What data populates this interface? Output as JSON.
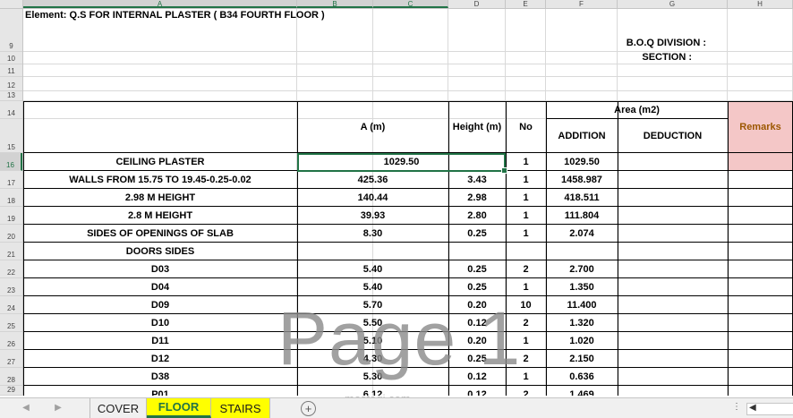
{
  "columns": [
    "A",
    "B",
    "C",
    "D",
    "E",
    "F",
    "G",
    "H"
  ],
  "row_numbers": [
    "9",
    "10",
    "11",
    "12",
    "13",
    "14",
    "15",
    "16",
    "17",
    "18",
    "19",
    "20",
    "21",
    "22",
    "23",
    "24",
    "25",
    "26",
    "27",
    "28",
    "29"
  ],
  "sheet": {
    "element_label": "Element: Q.S FOR INTERNAL PLASTER  ( B34 FOURTH FLOOR )",
    "boq_division": "B.O.Q DIVISION :",
    "section": "SECTION :"
  },
  "table_header": {
    "a_m": "A (m)",
    "height_m": "Height (m)",
    "no": "No",
    "area_m2": "Area  (m2)",
    "addition": "ADDITION",
    "deduction": "DEDUCTION",
    "remarks": "Remarks"
  },
  "rows": [
    {
      "label": "CEILING PLASTER",
      "a": "1029.50",
      "h": "",
      "no": "1",
      "add": "1029.50"
    },
    {
      "label": "WALLS FROM 15.75 TO 19.45-0.25-0.02",
      "a": "425.36",
      "h": "3.43",
      "no": "1",
      "add": "1458.987"
    },
    {
      "label": "2.98 M HEIGHT",
      "a": "140.44",
      "h": "2.98",
      "no": "1",
      "add": "418.511"
    },
    {
      "label": "2.8 M HEIGHT",
      "a": "39.93",
      "h": "2.80",
      "no": "1",
      "add": "111.804"
    },
    {
      "label": "SIDES OF OPENINGS OF SLAB",
      "a": "8.30",
      "h": "0.25",
      "no": "1",
      "add": "2.074"
    },
    {
      "label": "DOORS SIDES",
      "a": "",
      "h": "",
      "no": "",
      "add": ""
    },
    {
      "label": "D03",
      "a": "5.40",
      "h": "0.25",
      "no": "2",
      "add": "2.700"
    },
    {
      "label": "D04",
      "a": "5.40",
      "h": "0.25",
      "no": "1",
      "add": "1.350"
    },
    {
      "label": "D09",
      "a": "5.70",
      "h": "0.20",
      "no": "10",
      "add": "11.400"
    },
    {
      "label": "D10",
      "a": "5.50",
      "h": "0.12",
      "no": "2",
      "add": "1.320"
    },
    {
      "label": "D11",
      "a": "5.10",
      "h": "0.20",
      "no": "1",
      "add": "1.020"
    },
    {
      "label": "D12",
      "a": "4.30",
      "h": "0.25",
      "no": "2",
      "add": "2.150"
    },
    {
      "label": "D38",
      "a": "5.30",
      "h": "0.12",
      "no": "1",
      "add": "0.636"
    },
    {
      "label": "P01",
      "a": "6.12",
      "h": "0.12",
      "no": "2",
      "add": "1.469"
    }
  ],
  "watermark": "Page 1",
  "watermark_small": "mostaqi.com",
  "tabs": {
    "cover": "COVER",
    "floor": "FLOOR",
    "stairs": "STAIRS",
    "add_sheet": "+",
    "menu": "⋮"
  },
  "colors": {
    "accent": "#217346",
    "remarks_fill": "#f4c7c7",
    "tab_yellow": "#ffff00"
  }
}
